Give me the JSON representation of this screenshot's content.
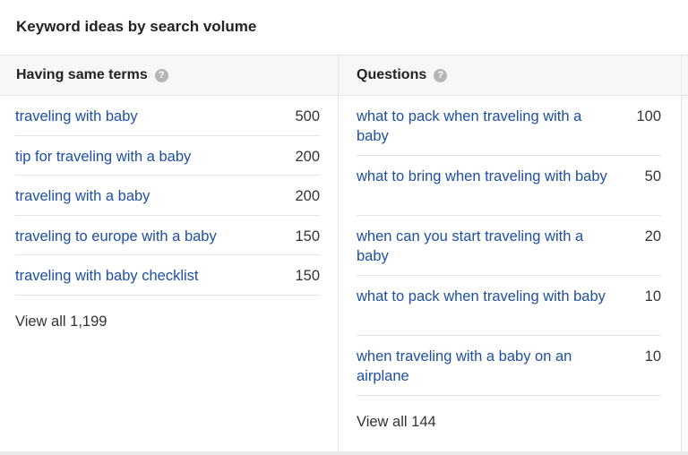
{
  "title": "Keyword ideas by search volume",
  "columns": {
    "left": {
      "header": "Having same terms",
      "help": "?",
      "rows": [
        {
          "keyword": "traveling with baby",
          "volume": "500"
        },
        {
          "keyword": "tip for traveling with a baby",
          "volume": "200"
        },
        {
          "keyword": "traveling with a baby",
          "volume": "200"
        },
        {
          "keyword": "traveling to europe with a baby",
          "volume": "150"
        },
        {
          "keyword": "traveling with baby checklist",
          "volume": "150"
        }
      ],
      "view_all": "View all 1,199"
    },
    "right": {
      "header": "Questions",
      "help": "?",
      "rows": [
        {
          "keyword": "what to pack when traveling with a baby",
          "volume": "100"
        },
        {
          "keyword": "what to bring when traveling with baby",
          "volume": "50"
        },
        {
          "keyword": "when can you start traveling with a baby",
          "volume": "20"
        },
        {
          "keyword": "what to pack when traveling with baby",
          "volume": "10"
        },
        {
          "keyword": "when traveling with a baby on an airplane",
          "volume": "10"
        }
      ],
      "view_all": "View all 144"
    }
  },
  "colors": {
    "link": "#1e4fa3",
    "header_bg": "#f6f7f8",
    "help_icon": "#b5b5b5"
  }
}
